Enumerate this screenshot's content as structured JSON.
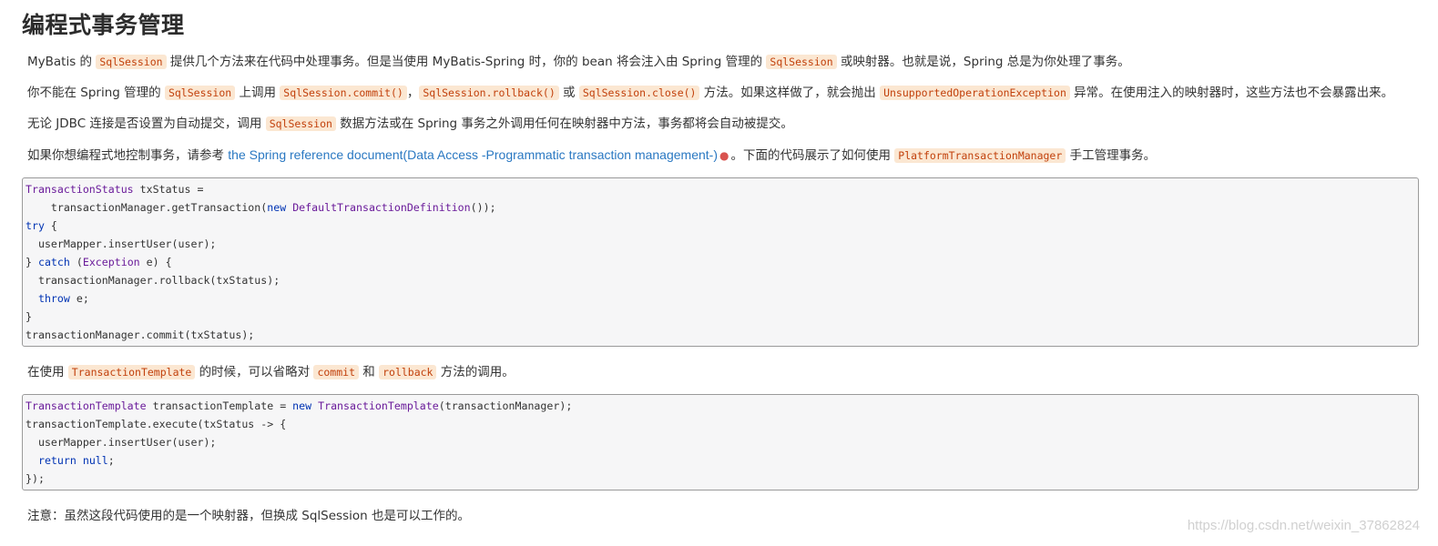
{
  "title": "编程式事务管理",
  "p1": {
    "a": "MyBatis 的 ",
    "c1": "SqlSession",
    "b": " 提供几个方法来在代码中处理事务。但是当使用 MyBatis-Spring 时，你的 bean 将会注入由 Spring 管理的 ",
    "c2": "SqlSession",
    "d": " 或映射器。也就是说，Spring 总是为你处理了事务。"
  },
  "p2": {
    "a": "你不能在 Spring 管理的 ",
    "c1": "SqlSession",
    "b": " 上调用 ",
    "c2": "SqlSession.commit()",
    "s1": "，",
    "c3": "SqlSession.rollback()",
    "s2": " 或 ",
    "c4": "SqlSession.close()",
    "d": " 方法。如果这样做了，就会抛出 ",
    "c5": "UnsupportedOperationException",
    "e": " 异常。在使用注入的映射器时，这些方法也不会暴露出来。"
  },
  "p3": {
    "a": "无论 JDBC 连接是否设置为自动提交，调用 ",
    "c1": "SqlSession",
    "b": " 数据方法或在 Spring 事务之外调用任何在映射器中方法，事务都将会自动被提交。"
  },
  "p4": {
    "a": "如果你想编程式地控制事务，请参考 ",
    "link": "the Spring reference document(Data Access -Programmatic transaction management-)",
    "b": "。下面的代码展示了如何使用 ",
    "c1": "PlatformTransactionManager",
    "d": " 手工管理事务。"
  },
  "code1": [
    "TransactionStatus txStatus =",
    "    transactionManager.getTransaction(new DefaultTransactionDefinition());",
    "try {",
    "  userMapper.insertUser(user);",
    "} catch (Exception e) {",
    "  transactionManager.rollback(txStatus);",
    "  throw e;",
    "}",
    "transactionManager.commit(txStatus);"
  ],
  "p5": {
    "a": "在使用 ",
    "c1": "TransactionTemplate",
    "b": " 的时候，可以省略对 ",
    "c2": "commit",
    "s1": " 和 ",
    "c3": "rollback",
    "d": " 方法的调用。"
  },
  "code2": [
    "TransactionTemplate transactionTemplate = new TransactionTemplate(transactionManager);",
    "transactionTemplate.execute(txStatus -> {",
    "  userMapper.insertUser(user);",
    "  return null;",
    "});"
  ],
  "note": "注意：虽然这段代码使用的是一个映射器，但换成 SqlSession 也是可以工作的。",
  "watermark": "https://blog.csdn.net/weixin_37862824",
  "colors": {
    "link": "#2a78c2",
    "inline_code_bg": "#fbe7d2",
    "inline_code_fg": "#c2410c",
    "code_bg": "#f6f6f7"
  },
  "icons": {
    "external_link": "external-link-icon"
  }
}
